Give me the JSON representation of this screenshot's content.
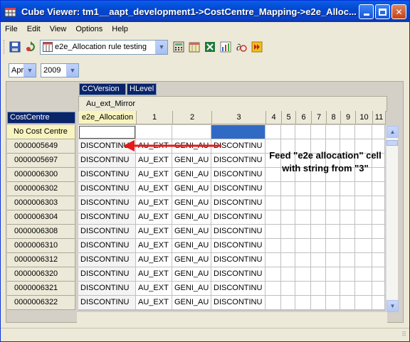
{
  "window": {
    "title": "Cube Viewer: tm1__aapt_development1->CostCentre_Mapping->e2e_Alloc..."
  },
  "menu": {
    "items": [
      "File",
      "Edit",
      "View",
      "Options",
      "Help"
    ]
  },
  "toolbar": {
    "view_name": "e2e_Allocation rule testing"
  },
  "filters": {
    "month": "Apr",
    "year": "2009"
  },
  "dimensions": {
    "col_dim1": "CCVersion",
    "col_dim2": "HLevel",
    "row_dim": "CostCentre",
    "mirror_label": "Au_ext_Mirror"
  },
  "columns": [
    "e2e_Allocation",
    "1",
    "2",
    "3",
    "4",
    "5",
    "6",
    "7",
    "8",
    "9",
    "10",
    "11"
  ],
  "rows": [
    {
      "label": "No Cost Centre",
      "c0": "",
      "c1": "",
      "c2": "",
      "c3": ""
    },
    {
      "label": "0000005649",
      "c0": "DISCONTINU",
      "c1": "AU_EXT",
      "c2": "GENI_AU",
      "c3": "DISCONTINU"
    },
    {
      "label": "0000005697",
      "c0": "DISCONTINU",
      "c1": "AU_EXT",
      "c2": "GENI_AU",
      "c3": "DISCONTINU"
    },
    {
      "label": "0000006300",
      "c0": "DISCONTINU",
      "c1": "AU_EXT",
      "c2": "GENI_AU",
      "c3": "DISCONTINU"
    },
    {
      "label": "0000006302",
      "c0": "DISCONTINU",
      "c1": "AU_EXT",
      "c2": "GENI_AU",
      "c3": "DISCONTINU"
    },
    {
      "label": "0000006303",
      "c0": "DISCONTINU",
      "c1": "AU_EXT",
      "c2": "GENI_AU",
      "c3": "DISCONTINU"
    },
    {
      "label": "0000006304",
      "c0": "DISCONTINU",
      "c1": "AU_EXT",
      "c2": "GENI_AU",
      "c3": "DISCONTINU"
    },
    {
      "label": "0000006308",
      "c0": "DISCONTINU",
      "c1": "AU_EXT",
      "c2": "GENI_AU",
      "c3": "DISCONTINU"
    },
    {
      "label": "0000006310",
      "c0": "DISCONTINU",
      "c1": "AU_EXT",
      "c2": "GENI_AU",
      "c3": "DISCONTINU"
    },
    {
      "label": "0000006312",
      "c0": "DISCONTINU",
      "c1": "AU_EXT",
      "c2": "GENI_AU",
      "c3": "DISCONTINU"
    },
    {
      "label": "0000006320",
      "c0": "DISCONTINU",
      "c1": "AU_EXT",
      "c2": "GENI_AU",
      "c3": "DISCONTINU"
    },
    {
      "label": "0000006321",
      "c0": "DISCONTINU",
      "c1": "AU_EXT",
      "c2": "GENI_AU",
      "c3": "DISCONTINU"
    },
    {
      "label": "0000006322",
      "c0": "DISCONTINU",
      "c1": "AU_EXT",
      "c2": "GENI_AU",
      "c3": "DISCONTINU"
    }
  ],
  "annotation": {
    "text": "Feed \"e2e allocation\" cell with string from \"3\""
  },
  "colors": {
    "titlebar": "#0348d0",
    "selection": "#316ac5",
    "arrow": "#e31b1b",
    "header_tag": "#0a246a"
  }
}
